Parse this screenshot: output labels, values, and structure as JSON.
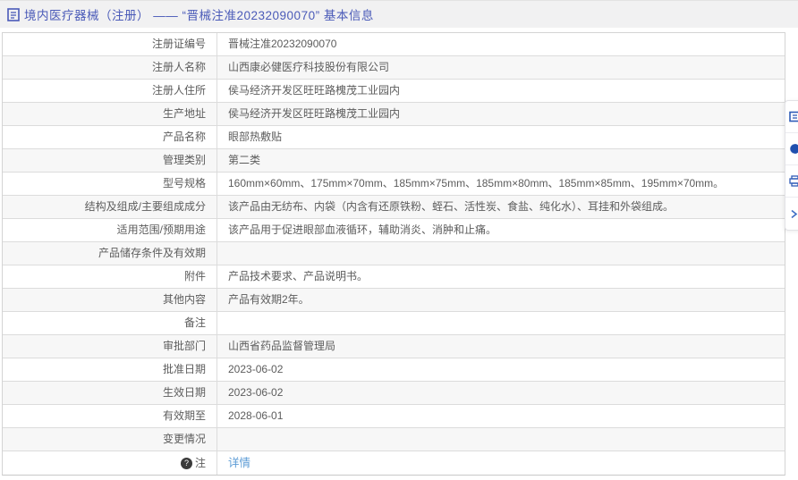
{
  "header": {
    "title": "境内医疗器械（注册） ——  “晋械注准20232090070”  基本信息"
  },
  "icons": {
    "note_glyph": "?"
  },
  "table": {
    "rows": [
      {
        "label": "注册证编号",
        "value": "晋械注准20232090070"
      },
      {
        "label": "注册人名称",
        "value": "山西康必健医疗科技股份有限公司"
      },
      {
        "label": "注册人住所",
        "value": "侯马经济开发区旺旺路槐茂工业园内"
      },
      {
        "label": "生产地址",
        "value": "侯马经济开发区旺旺路槐茂工业园内"
      },
      {
        "label": "产品名称",
        "value": "眼部热敷贴"
      },
      {
        "label": "管理类别",
        "value": "第二类"
      },
      {
        "label": "型号规格",
        "value": "160mm×60mm、175mm×70mm、185mm×75mm、185mm×80mm、185mm×85mm、195mm×70mm。"
      },
      {
        "label": "结构及组成/主要组成成分",
        "value": "该产品由无纺布、内袋（内含有还原铁粉、蛭石、活性炭、食盐、纯化水）、耳挂和外袋组成。"
      },
      {
        "label": "适用范围/预期用途",
        "value": "该产品用于促进眼部血液循环，辅助消炎、消肿和止痛。"
      },
      {
        "label": "产品储存条件及有效期",
        "value": ""
      },
      {
        "label": "附件",
        "value": "产品技术要求、产品说明书。"
      },
      {
        "label": "其他内容",
        "value": "产品有效期2年。"
      },
      {
        "label": "备注",
        "value": ""
      },
      {
        "label": "审批部门",
        "value": "山西省药品监督管理局"
      },
      {
        "label": "批准日期",
        "value": "2023-06-02"
      },
      {
        "label": "生效日期",
        "value": "2023-06-02"
      },
      {
        "label": "有效期至",
        "value": "2028-06-01"
      },
      {
        "label": "变更情况",
        "value": ""
      },
      {
        "label": "注",
        "value": "详情",
        "type": "link",
        "note_icon": true
      }
    ]
  },
  "colors": {
    "title_blue": "#4a5ab8",
    "link_blue": "#5b9bd5",
    "toolbar_icon_blue": "#2f5bb7",
    "row_alt_gray": "#f7f7f7",
    "border_gray": "#dcdcdc"
  }
}
